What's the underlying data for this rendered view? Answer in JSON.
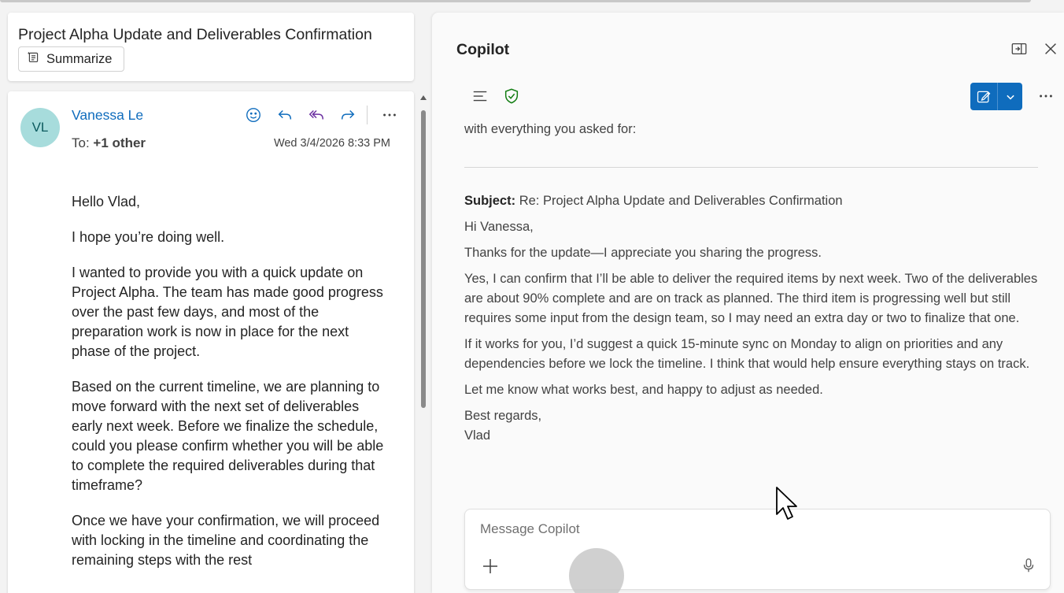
{
  "email": {
    "subject": "Project Alpha Update and Deliverables Confirmation",
    "summarize_label": "Summarize",
    "sender": {
      "initials": "VL",
      "name": "Vanessa Le",
      "avatar_color": "#a7dcdc"
    },
    "to_label": "To:",
    "to_value": "+1 other",
    "date": "Wed 3/4/2026 8:33 PM",
    "actions": [
      "emoji-icon",
      "reply-icon",
      "reply-all-icon",
      "forward-icon",
      "more-icon"
    ],
    "body": [
      "Hello Vlad,",
      "I hope you’re doing well.",
      "I wanted to provide you with a quick update on Project Alpha. The team has made good progress over the past few days, and most of the preparation work is now in place for the next phase of the project.",
      "Based on the current timeline, we are planning to move forward with the next set of deliverables early next week. Before we finalize the schedule, could you please confirm whether you will be able to complete the required deliverables during that timeframe?",
      "Once we have your confirmation, we will proceed with locking in the timeline and coordinating the remaining steps with the rest"
    ]
  },
  "copilot": {
    "title": "Copilot",
    "lead_text": "with everything you asked for:",
    "reply": {
      "subject_label": "Subject:",
      "subject_value": "Re: Project Alpha Update and Deliverables Confirmation",
      "greeting": "Hi Vanessa,",
      "paragraphs": [
        "Thanks for the update—I appreciate you sharing the progress.",
        "Yes, I can confirm that I’ll be able to deliver the required items by next week. Two of the deliverables are about 90% complete and are on track as planned. The third item is progressing well but still requires some input from the design team, so I may need an extra day or two to finalize that one.",
        "If it works for you, I’d suggest a quick 15-minute sync on Monday to align on priorities and any dependencies before we lock the timeline. I think that would help ensure everything stays on track.",
        "Let me know what works best, and happy to adjust as needed."
      ],
      "signoff": "Best regards,",
      "signature": "Vlad"
    },
    "composer_placeholder": "Message Copilot",
    "accent_color": "#0f6cbd",
    "shield_color": "#107c10"
  }
}
